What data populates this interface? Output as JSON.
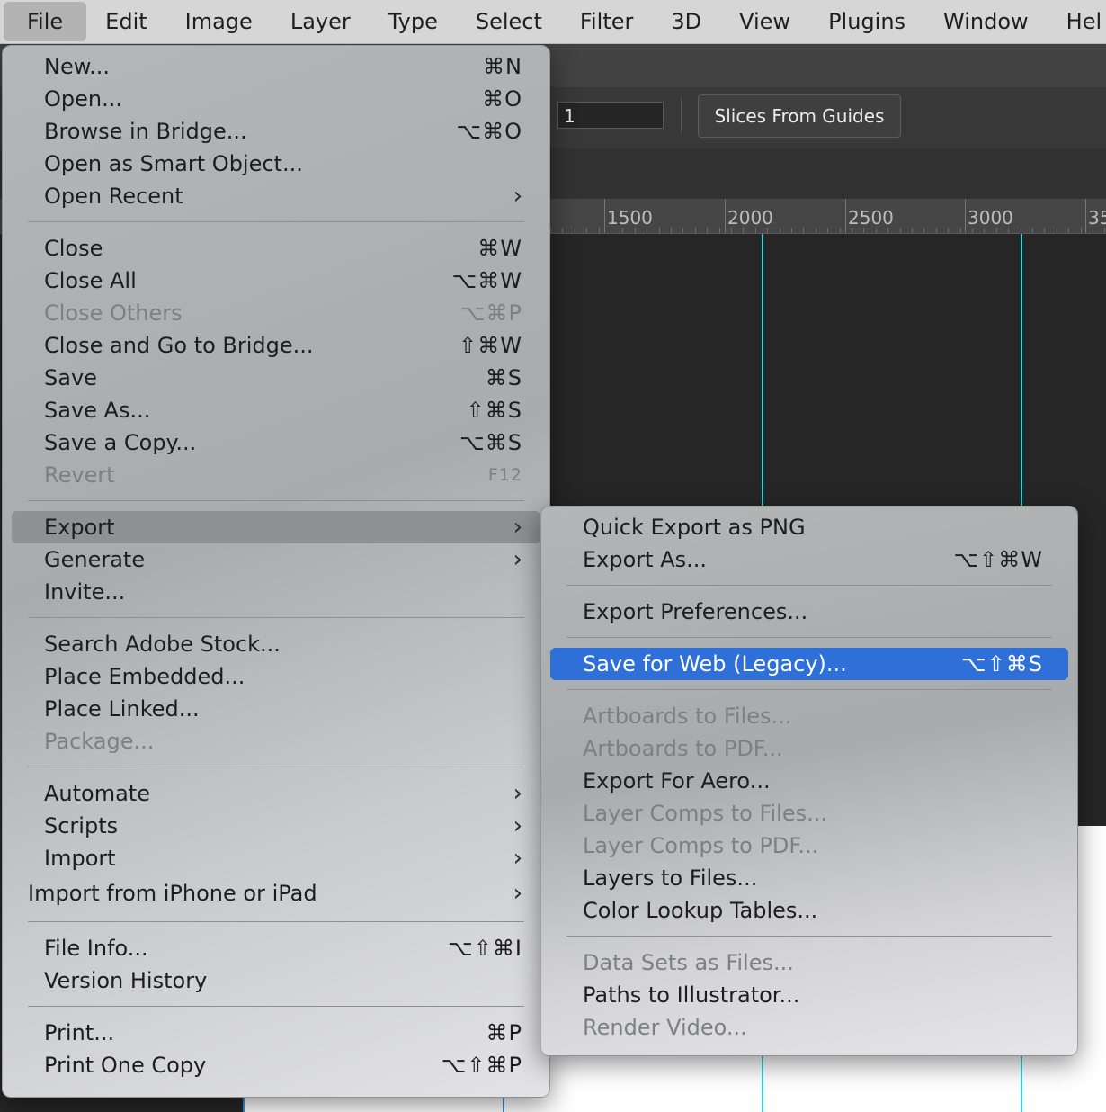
{
  "menubar": {
    "items": [
      "File",
      "Edit",
      "Image",
      "Layer",
      "Type",
      "Select",
      "Filter",
      "3D",
      "View",
      "Plugins",
      "Window",
      "Hel"
    ]
  },
  "toolbar": {
    "field_value": "1",
    "slices_button": "Slices From Guides"
  },
  "ruler": {
    "labels": [
      "1500",
      "2000",
      "2500",
      "3000",
      "35"
    ]
  },
  "file_menu": {
    "groups": [
      [
        {
          "label": "New...",
          "shortcut": "⌘N"
        },
        {
          "label": "Open...",
          "shortcut": "⌘O"
        },
        {
          "label": "Browse in Bridge...",
          "shortcut": "⌥⌘O"
        },
        {
          "label": "Open as Smart Object..."
        },
        {
          "label": "Open Recent",
          "submenu": true
        }
      ],
      [
        {
          "label": "Close",
          "shortcut": "⌘W"
        },
        {
          "label": "Close All",
          "shortcut": "⌥⌘W"
        },
        {
          "label": "Close Others",
          "shortcut": "⌥⌘P",
          "disabled": true
        },
        {
          "label": "Close and Go to Bridge...",
          "shortcut": "⇧⌘W"
        },
        {
          "label": "Save",
          "shortcut": "⌘S"
        },
        {
          "label": "Save As...",
          "shortcut": "⇧⌘S"
        },
        {
          "label": "Save a Copy...",
          "shortcut": "⌥⌘S"
        },
        {
          "label": "Revert",
          "shortcut": "F12",
          "disabled": true,
          "small": true
        }
      ],
      [
        {
          "label": "Export",
          "submenu": true,
          "hover": true
        },
        {
          "label": "Generate",
          "submenu": true
        },
        {
          "label": "Invite..."
        }
      ],
      [
        {
          "label": "Search Adobe Stock..."
        },
        {
          "label": "Place Embedded..."
        },
        {
          "label": "Place Linked..."
        },
        {
          "label": "Package...",
          "disabled": true
        }
      ],
      [
        {
          "label": "Automate",
          "submenu": true
        },
        {
          "label": "Scripts",
          "submenu": true
        },
        {
          "label": "Import",
          "submenu": true
        },
        {
          "label": "Import from iPhone or iPad",
          "submenu": true,
          "outdent": true
        }
      ],
      [
        {
          "label": "File Info...",
          "shortcut": "⌥⇧⌘I"
        },
        {
          "label": "Version History"
        }
      ],
      [
        {
          "label": "Print...",
          "shortcut": "⌘P"
        },
        {
          "label": "Print One Copy",
          "shortcut": "⌥⇧⌘P"
        }
      ]
    ]
  },
  "export_menu": {
    "groups": [
      [
        {
          "label": "Quick Export as PNG"
        },
        {
          "label": "Export As...",
          "shortcut": "⌥⇧⌘W"
        }
      ],
      [
        {
          "label": "Export Preferences..."
        }
      ],
      [
        {
          "label": "Save for Web (Legacy)...",
          "shortcut": "⌥⇧⌘S",
          "selected": true
        }
      ],
      [
        {
          "label": "Artboards to Files...",
          "disabled": true
        },
        {
          "label": "Artboards to PDF...",
          "disabled": true
        },
        {
          "label": "Export For Aero..."
        },
        {
          "label": "Layer Comps to Files...",
          "disabled": true
        },
        {
          "label": "Layer Comps to PDF...",
          "disabled": true
        },
        {
          "label": "Layers to Files..."
        },
        {
          "label": "Color Lookup Tables..."
        }
      ],
      [
        {
          "label": "Data Sets as Files...",
          "disabled": true
        },
        {
          "label": "Paths to Illustrator..."
        },
        {
          "label": "Render Video...",
          "disabled": true
        }
      ]
    ]
  },
  "colors": {
    "highlight": "#2f6fd8",
    "guide": "#2bd4e6"
  }
}
